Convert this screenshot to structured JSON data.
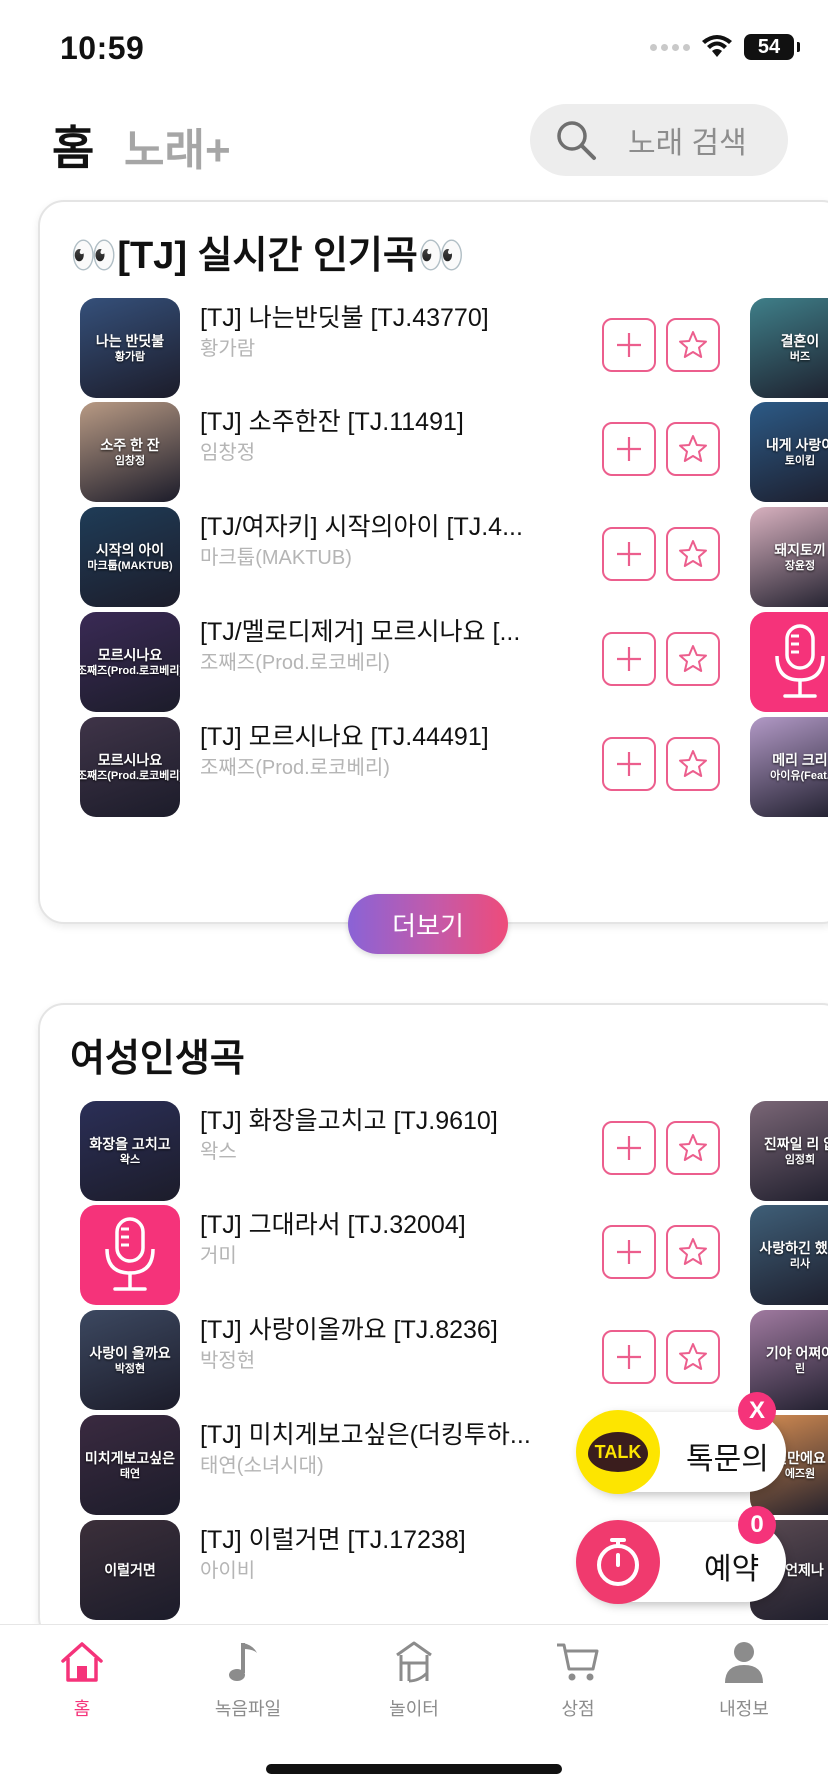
{
  "status_bar": {
    "time": "10:59",
    "battery": "54"
  },
  "header": {
    "tab_home": "홈",
    "tab_songs": "노래+",
    "search_placeholder": "노래 검색"
  },
  "sections": [
    {
      "title": "👀[TJ] 실시간 인기곡👀",
      "songs": [
        {
          "title": "[TJ] 나는반딧불 [TJ.43770]",
          "artist": "황가람",
          "thumb_title": "나는 반딧불",
          "thumb_artist": "황가람",
          "thumb_color": "#35507a"
        },
        {
          "title": "[TJ] 소주한잔 [TJ.11491]",
          "artist": "임창정",
          "thumb_title": "소주 한 잔",
          "thumb_artist": "임창정",
          "thumb_color": "#b89a84"
        },
        {
          "title": "[TJ/여자키] 시작의아이 [TJ.4...",
          "artist": "마크툽(MAKTUB)",
          "thumb_title": "시작의 아이",
          "thumb_artist": "마크툽(MAKTUB)",
          "thumb_color": "#1f3c57"
        },
        {
          "title": "[TJ/멜로디제거] 모르시나요 [...",
          "artist": "조째즈(Prod.로코베리)",
          "thumb_title": "모르시나요",
          "thumb_artist": "조째즈(Prod.로코베리)",
          "thumb_color": "#3a2a55"
        },
        {
          "title": "[TJ] 모르시나요 [TJ.44491]",
          "artist": "조째즈(Prod.로코베리)",
          "thumb_title": "모르시나요",
          "thumb_artist": "조째즈(Prod.로코베리)",
          "thumb_color": "#3f3448"
        }
      ],
      "side_thumbs": [
        {
          "title": "결혼이",
          "artist": "버즈",
          "color": "#3f7f89"
        },
        {
          "title": "내게 사랑이",
          "artist": "토이킴",
          "color": "#2c5a86"
        },
        {
          "title": "돼지토끼",
          "artist": "장윤정",
          "color": "#d8b1bf"
        },
        {
          "title": "",
          "artist": "",
          "color": "#f5337a"
        },
        {
          "title": "메리 크리",
          "artist": "아이유(Feat.",
          "color": "#b299c6"
        }
      ],
      "more_label": "더보기"
    },
    {
      "title": "여성인생곡",
      "songs": [
        {
          "title": "[TJ] 화장을고치고 [TJ.9610]",
          "artist": "왁스",
          "thumb_title": "화장을 고치고",
          "thumb_artist": "왁스",
          "thumb_color": "#2b2f57"
        },
        {
          "title": "[TJ] 그대라서 [TJ.32004]",
          "artist": "거미",
          "thumb_title": "",
          "thumb_artist": "",
          "thumb_color": "#f5337a"
        },
        {
          "title": "[TJ] 사랑이올까요 [TJ.8236]",
          "artist": "박정현",
          "thumb_title": "사랑이 올까요",
          "thumb_artist": "박정현",
          "thumb_color": "#3c4860"
        },
        {
          "title": "[TJ] 미치게보고싶은(더킹투하...",
          "artist": "태연(소녀시대)",
          "thumb_title": "미치게보고싶은",
          "thumb_artist": "태연",
          "thumb_color": "#3a2a40"
        },
        {
          "title": "[TJ] 이럴거면 [TJ.17238]",
          "artist": "아이비",
          "thumb_title": "이럴거면",
          "thumb_artist": "",
          "thumb_color": "#3b2f3a"
        }
      ],
      "side_thumbs": [
        {
          "title": "진짜일 리 없",
          "artist": "임정희",
          "color": "#7a6676"
        },
        {
          "title": "사랑하긴 했었",
          "artist": "리사",
          "color": "#3f5f78"
        },
        {
          "title": "기야 어쩌야",
          "artist": "린",
          "color": "#a07aa0"
        },
        {
          "title": "천만에요",
          "artist": "에즈원",
          "color": "#d48c52"
        },
        {
          "title": "창은언제나 옥",
          "artist": "",
          "color": "#5a4a52"
        }
      ]
    }
  ],
  "floating": {
    "talk_label": "톡문의",
    "talk_icon_text": "TALK",
    "close_label": "X",
    "reserve_label": "예약",
    "reserve_count": "0"
  },
  "nav": [
    {
      "label": "홈",
      "icon": "home-icon"
    },
    {
      "label": "녹음파일",
      "icon": "music-note-icon"
    },
    {
      "label": "놀이터",
      "icon": "playground-icon"
    },
    {
      "label": "상점",
      "icon": "cart-icon"
    },
    {
      "label": "내정보",
      "icon": "person-icon"
    }
  ],
  "colors": {
    "accent": "#f5337a",
    "button_border": "#ec5e8d",
    "muted": "#b5b5b5"
  }
}
